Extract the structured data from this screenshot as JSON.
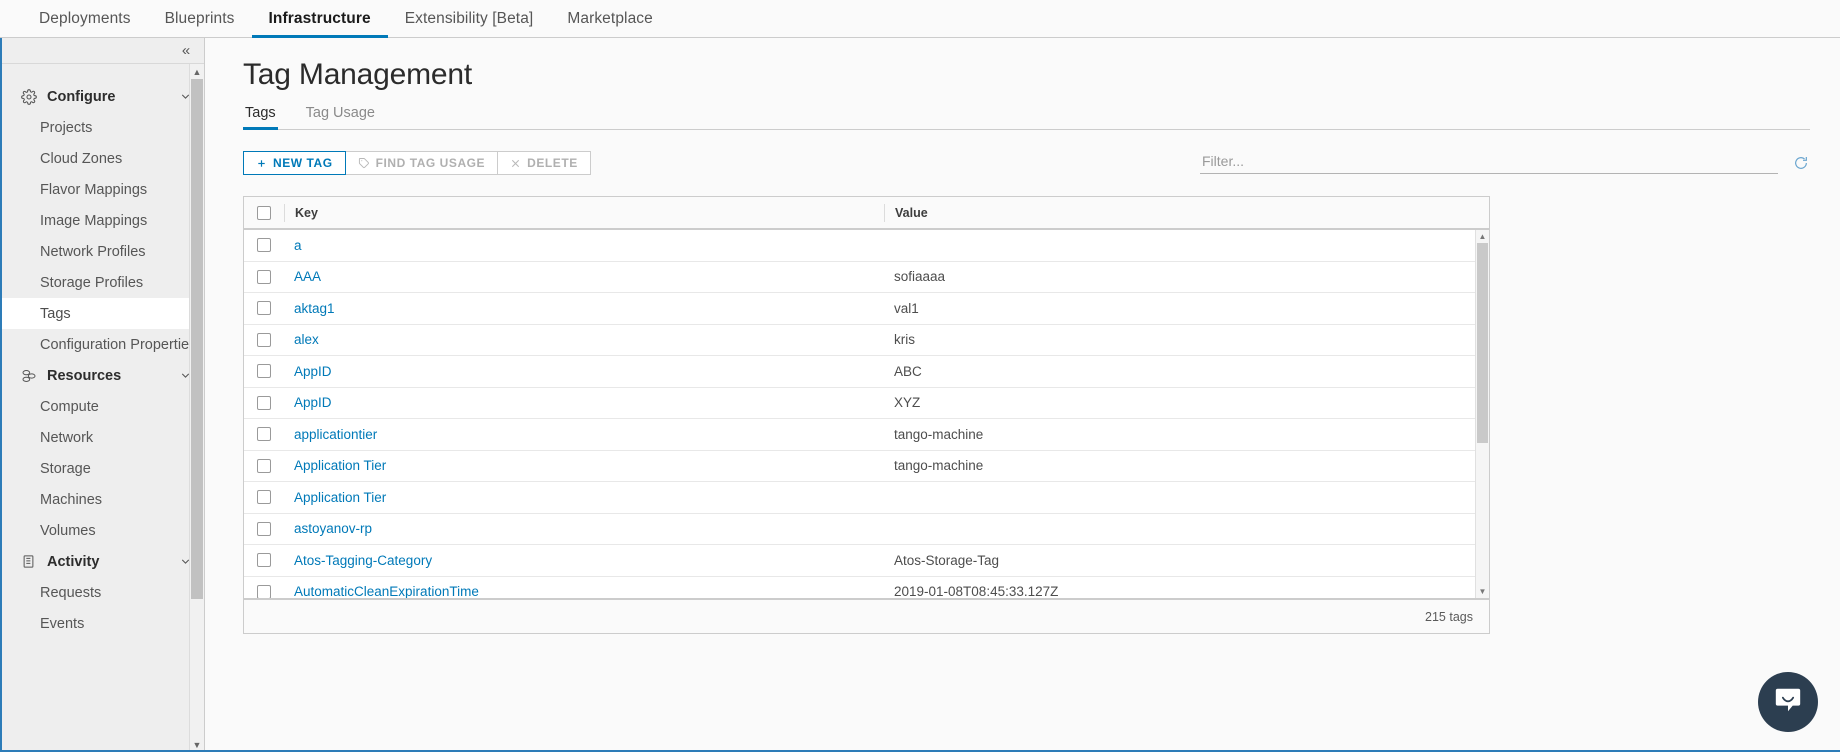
{
  "topnav": {
    "items": [
      {
        "label": "Deployments",
        "active": false
      },
      {
        "label": "Blueprints",
        "active": false
      },
      {
        "label": "Infrastructure",
        "active": true
      },
      {
        "label": "Extensibility [Beta]",
        "active": false
      },
      {
        "label": "Marketplace",
        "active": false
      }
    ]
  },
  "sidebar": {
    "collapse_icon": "«",
    "groups": [
      {
        "label": "Configure",
        "icon": "gear-icon",
        "chevron": "chevron-down-icon",
        "items": [
          {
            "label": "Projects",
            "active": false
          },
          {
            "label": "Cloud Zones",
            "active": false
          },
          {
            "label": "Flavor Mappings",
            "active": false
          },
          {
            "label": "Image Mappings",
            "active": false
          },
          {
            "label": "Network Profiles",
            "active": false
          },
          {
            "label": "Storage Profiles",
            "active": false
          },
          {
            "label": "Tags",
            "active": true
          },
          {
            "label": "Configuration Properties",
            "active": false
          }
        ]
      },
      {
        "label": "Resources",
        "icon": "resources-icon",
        "chevron": "chevron-down-icon",
        "items": [
          {
            "label": "Compute",
            "active": false
          },
          {
            "label": "Network",
            "active": false
          },
          {
            "label": "Storage",
            "active": false
          },
          {
            "label": "Machines",
            "active": false
          },
          {
            "label": "Volumes",
            "active": false
          }
        ]
      },
      {
        "label": "Activity",
        "icon": "activity-icon",
        "chevron": "chevron-down-icon",
        "items": [
          {
            "label": "Requests",
            "active": false
          },
          {
            "label": "Events",
            "active": false
          }
        ]
      }
    ]
  },
  "main": {
    "title": "Tag Management",
    "tabs": [
      {
        "label": "Tags",
        "active": true
      },
      {
        "label": "Tag Usage",
        "active": false
      }
    ],
    "toolbar": {
      "new_tag": {
        "label": "NEW TAG",
        "icon": "plus-icon"
      },
      "find_tag_usage": {
        "label": "FIND TAG USAGE",
        "icon": "tag-icon"
      },
      "delete": {
        "label": "DELETE",
        "icon": "close-icon"
      }
    },
    "filter": {
      "placeholder": "Filter...",
      "value": "",
      "refresh_icon": "refresh-icon"
    },
    "table": {
      "columns": [
        "Key",
        "Value"
      ],
      "rows": [
        {
          "key": "a",
          "value": ""
        },
        {
          "key": "AAA",
          "value": "sofiaaaa"
        },
        {
          "key": "aktag1",
          "value": "val1"
        },
        {
          "key": "alex",
          "value": "kris"
        },
        {
          "key": "AppID",
          "value": "ABC"
        },
        {
          "key": "AppID",
          "value": "XYZ"
        },
        {
          "key": "applicationtier",
          "value": "tango-machine"
        },
        {
          "key": "Application Tier",
          "value": "tango-machine"
        },
        {
          "key": "Application Tier",
          "value": ""
        },
        {
          "key": "astoyanov-rp",
          "value": ""
        },
        {
          "key": "Atos-Tagging-Category",
          "value": "Atos-Storage-Tag"
        },
        {
          "key": "AutomaticCleanExpirationTime",
          "value": "2019-01-08T08:45:33.127Z"
        }
      ],
      "footer_count": "215 tags"
    }
  },
  "chat": {
    "icon": "chat-bubble-icon"
  },
  "colors": {
    "accent": "#0079b8",
    "link": "#0079b8",
    "sidebar_bg": "#eeeeee",
    "chat_bg": "#2c3e50"
  }
}
